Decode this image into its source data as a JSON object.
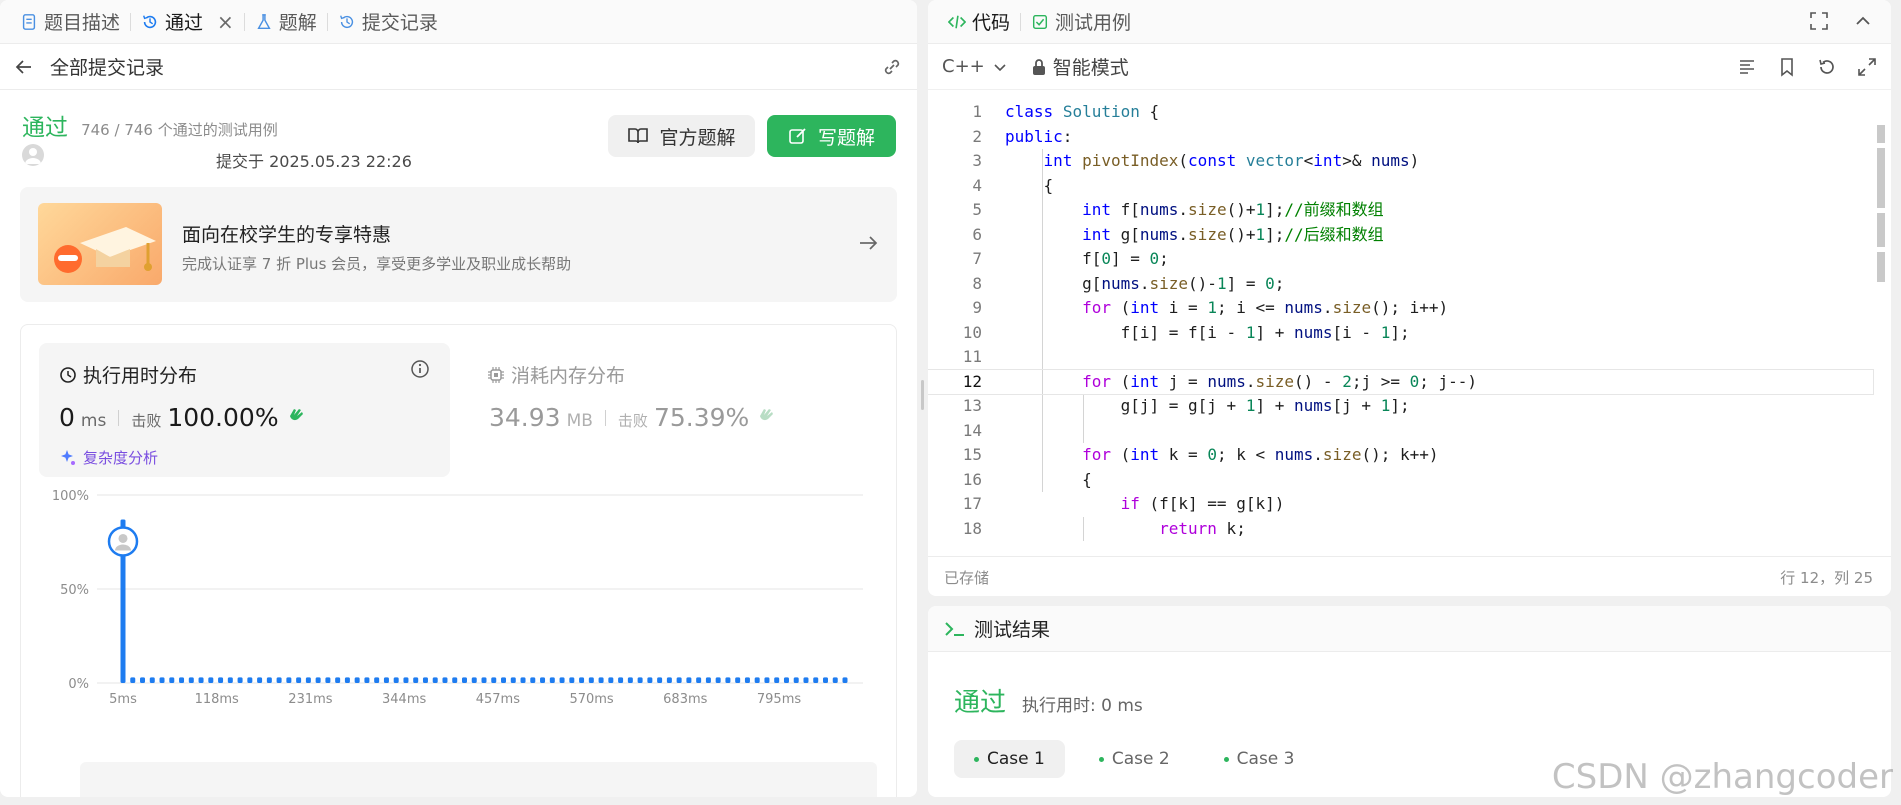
{
  "left_tabs": {
    "description": "题目描述",
    "accepted": "通过",
    "solutions": "题解",
    "submissions": "提交记录",
    "close": "×"
  },
  "back_bar": {
    "title": "全部提交记录"
  },
  "submission": {
    "status": "通过",
    "count": "746 / 746 个通过的测试用例",
    "submitted_at": "提交于 2025.05.23 22:26",
    "btn_official": "官方题解",
    "btn_write": "写题解"
  },
  "promo": {
    "title": "面向在校学生的专享特惠",
    "subtitle": "完成认证享 7 折 Plus 会员，享受更多学业及职业成长帮助"
  },
  "runtime": {
    "title": "执行用时分布",
    "value": "0",
    "unit": "ms",
    "beat_label": "击败",
    "beat_pct": "100.00%",
    "complexity": "复杂度分析"
  },
  "memory": {
    "title": "消耗内存分布",
    "value": "34.93",
    "unit": "MB",
    "beat_label": "击败",
    "beat_pct": "75.39%"
  },
  "chart_data": {
    "type": "bar",
    "y_ticks": [
      "100%",
      "50%",
      "0%"
    ],
    "x_ticks": [
      "5ms",
      "118ms",
      "231ms",
      "344ms",
      "457ms",
      "570ms",
      "683ms",
      "795ms"
    ],
    "ylim": [
      0,
      100
    ],
    "highlight_index": 0,
    "values": [
      87,
      3,
      3,
      3,
      3,
      3,
      3,
      3,
      3,
      3,
      3,
      3,
      3,
      3,
      3,
      3,
      3,
      3,
      3,
      3,
      3,
      3,
      3,
      3,
      3,
      3,
      3,
      3,
      3,
      3,
      3,
      3,
      3,
      3,
      3,
      3,
      3,
      3,
      3,
      3,
      3,
      3,
      3,
      3,
      3,
      3,
      3,
      3,
      3,
      3,
      3,
      3,
      3,
      3,
      3,
      3,
      3,
      3,
      3,
      3,
      3,
      3,
      3,
      3,
      3,
      3,
      3,
      3,
      3,
      3,
      3,
      3,
      3,
      3,
      3
    ],
    "bar_color": "#1e7cf0"
  },
  "editor_tabs": {
    "code": "代码",
    "tests": "测试用例"
  },
  "editor": {
    "language": "C++",
    "mode": "智能模式",
    "saved": "已存储",
    "cursor": "行 12，列 25",
    "lines": [
      "1",
      "2",
      "3",
      "4",
      "5",
      "6",
      "7",
      "8",
      "9",
      "10",
      "11",
      "12",
      "13",
      "14",
      "15",
      "16",
      "17",
      "18"
    ]
  },
  "result": {
    "title": "测试结果",
    "status": "通过",
    "time": "执行用时: 0 ms",
    "cases": [
      "Case 1",
      "Case 2",
      "Case 3"
    ]
  },
  "watermark": "CSDN @zhangcoder"
}
